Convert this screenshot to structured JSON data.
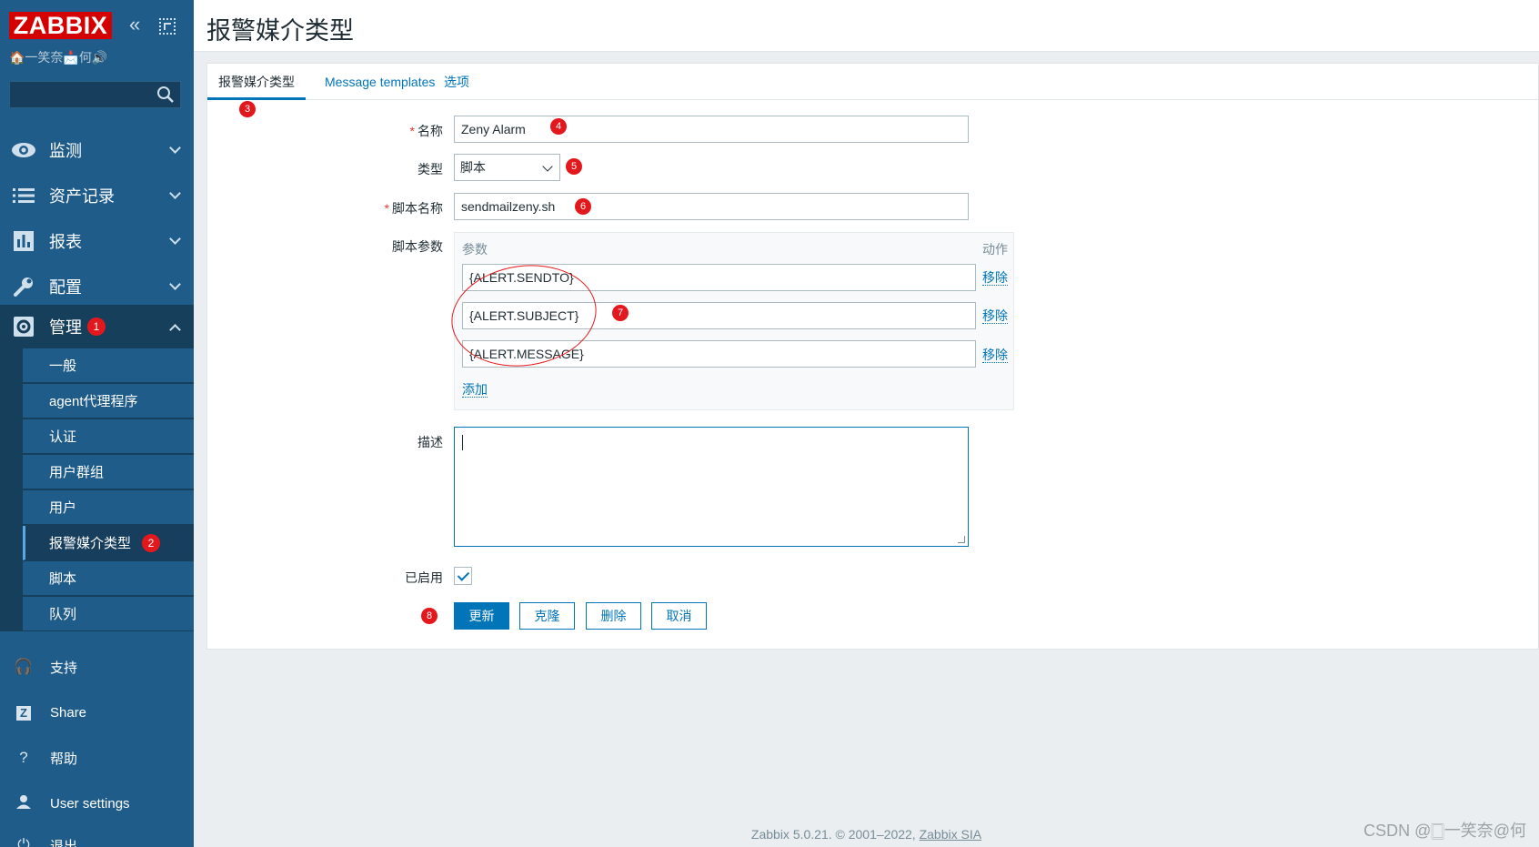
{
  "sidebar": {
    "logo": "ZABBIX",
    "server_name": "🏠一笑奈📩何🔊",
    "search_placeholder": "",
    "menu": [
      {
        "label": "监测",
        "icon": "eye-icon"
      },
      {
        "label": "资产记录",
        "icon": "list-icon"
      },
      {
        "label": "报表",
        "icon": "bar-chart-icon"
      },
      {
        "label": "配置",
        "icon": "wrench-icon"
      },
      {
        "label": "管理",
        "icon": "gear-icon",
        "badge": "1"
      }
    ],
    "submenu": [
      {
        "label": "一般"
      },
      {
        "label": "agent代理程序"
      },
      {
        "label": "认证"
      },
      {
        "label": "用户群组"
      },
      {
        "label": "用户"
      },
      {
        "label": "报警媒介类型",
        "badge": "2"
      },
      {
        "label": "脚本"
      },
      {
        "label": "队列"
      }
    ],
    "bottom": [
      {
        "label": "支持",
        "icon": "headset-icon"
      },
      {
        "label": "Share",
        "icon": "share-icon"
      },
      {
        "label": "帮助",
        "icon": "help-icon"
      },
      {
        "label": "User settings",
        "icon": "user-icon"
      },
      {
        "label": "退出",
        "icon": "power-icon"
      }
    ]
  },
  "header": {
    "title": "报警媒介类型"
  },
  "tabs": [
    {
      "label": "报警媒介类型",
      "active": true
    },
    {
      "label": "Message templates",
      "active": false
    },
    {
      "label": "选项",
      "active": false
    }
  ],
  "form": {
    "name_label": "名称",
    "name_value": "Zeny Alarm",
    "type_label": "类型",
    "type_value": "脚本",
    "script_name_label": "脚本名称",
    "script_name_value": "sendmailzeny.sh",
    "params_label": "脚本参数",
    "params_col_param": "参数",
    "params_col_action": "动作",
    "params": [
      "{ALERT.SENDTO}",
      "{ALERT.SUBJECT}",
      "{ALERT.MESSAGE}"
    ],
    "remove_label": "移除",
    "add_label": "添加",
    "description_label": "描述",
    "description_value": "",
    "enabled_label": "已启用",
    "enabled": true
  },
  "buttons": {
    "update": "更新",
    "clone": "克隆",
    "delete": "删除",
    "cancel": "取消"
  },
  "annotations": [
    "3",
    "4",
    "5",
    "6",
    "7",
    "8"
  ],
  "footer": {
    "text": "Zabbix 5.0.21. © 2001–2022, ",
    "link": "Zabbix SIA"
  },
  "watermark": "CSDN @🀆一笑奈@何",
  "colors": {
    "sidebar": "#1f5c8a",
    "accent": "#0275b8",
    "logo": "#d40000",
    "annotation": "#e3181c"
  }
}
